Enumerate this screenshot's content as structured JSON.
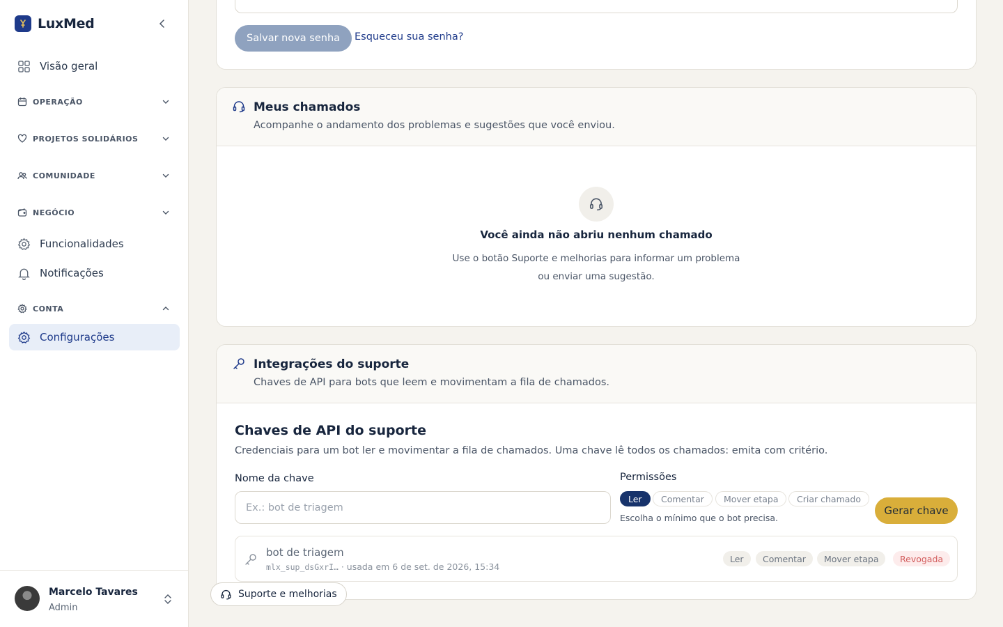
{
  "brand": {
    "name": "LuxMed"
  },
  "sidebar": {
    "items": [
      {
        "label": "Visão geral",
        "icon": "grid-icon"
      },
      {
        "label": "OPERAÇÃO",
        "icon": "calendar-icon",
        "type": "section"
      },
      {
        "label": "PROJETOS SOLIDÁRIOS",
        "icon": "heart-icon",
        "type": "section"
      },
      {
        "label": "COMUNIDADE",
        "icon": "users-icon",
        "type": "section"
      },
      {
        "label": "NEGÓCIO",
        "icon": "wallet-icon",
        "type": "section"
      },
      {
        "label": "Funcionalidades",
        "icon": "gear-icon"
      },
      {
        "label": "Notificações",
        "icon": "bell-icon"
      },
      {
        "label": "CONTA",
        "icon": "gear-icon",
        "type": "section"
      },
      {
        "label": "Configurações",
        "icon": "gear-icon",
        "active": true
      }
    ]
  },
  "user": {
    "name": "Marcelo Tavares",
    "role": "Admin"
  },
  "password": {
    "save_label": "Salvar nova senha",
    "forgot_label": "Esqueceu sua senha?"
  },
  "tickets": {
    "title": "Meus chamados",
    "subtitle": "Acompanhe o andamento dos problemas e sugestões que você enviou.",
    "empty_title": "Você ainda não abriu nenhum chamado",
    "empty_desc": "Use o botão Suporte e melhorias para informar um problema ou enviar uma sugestão."
  },
  "integrations": {
    "title": "Integrações do suporte",
    "subtitle": "Chaves de API para bots que leem e movimentam a fila de chamados.",
    "api_title": "Chaves de API do suporte",
    "api_desc": "Credenciais para um bot ler e movimentar a fila de chamados. Uma chave lê todos os chamados: emita com critério.",
    "key_name_label": "Nome da chave",
    "key_name_placeholder": "Ex.: bot de triagem",
    "permissions_label": "Permissões",
    "permissions": [
      {
        "label": "Ler",
        "selected": true
      },
      {
        "label": "Comentar",
        "selected": false
      },
      {
        "label": "Mover etapa",
        "selected": false
      },
      {
        "label": "Criar chamado",
        "selected": false
      }
    ],
    "permissions_hint": "Escolha o mínimo que o bot precisa.",
    "generate_label": "Gerar chave",
    "keys": [
      {
        "name": "bot de triagem",
        "prefix": "mlx_sup_dsGxrI…",
        "usage": " · usada em 6 de set. de 2026, 15:34",
        "tags": [
          "Ler",
          "Comentar",
          "Mover etapa"
        ],
        "status": "Revogada"
      }
    ]
  },
  "support_button": {
    "label": "Suporte e melhorias"
  },
  "colors": {
    "brand": "#1e3a8a",
    "accent": "#d9ae3a",
    "revoked": "#d25c5c"
  }
}
